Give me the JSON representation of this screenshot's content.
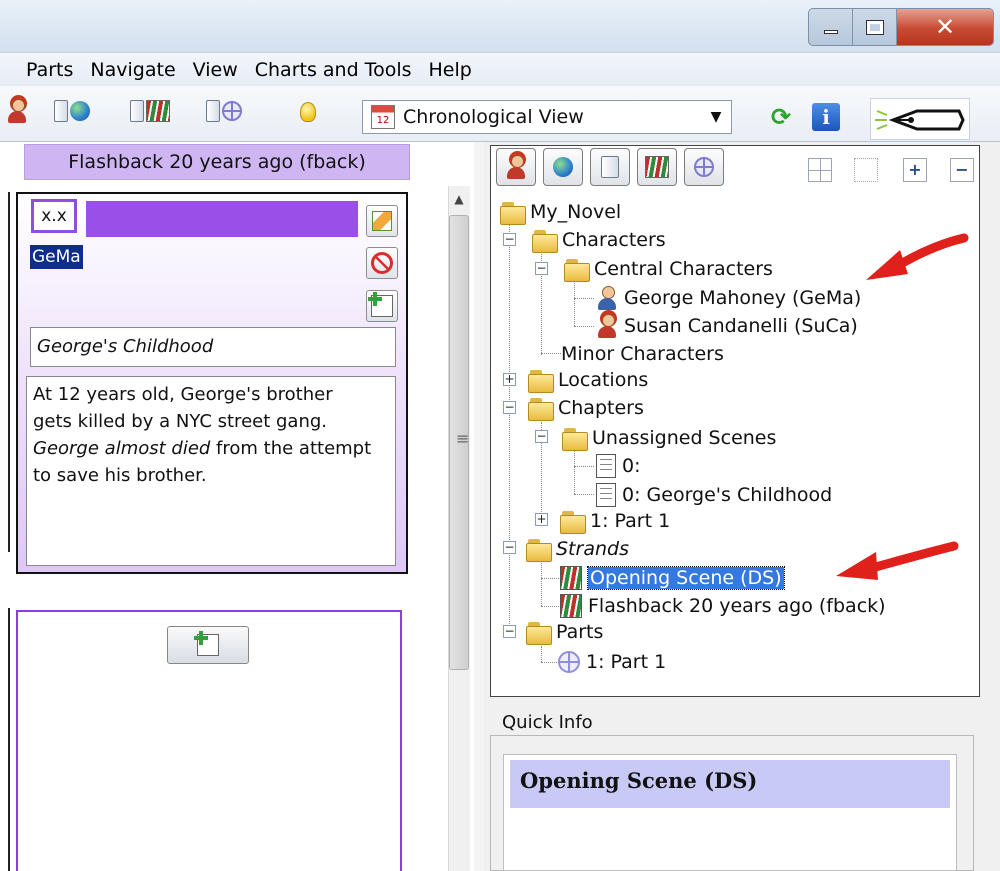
{
  "menu": {
    "items": [
      "Parts",
      "Navigate",
      "View",
      "Charts and Tools",
      "Help"
    ]
  },
  "toolbar": {
    "view_select_value": "Chronological View",
    "calendar_number": "12"
  },
  "window": {
    "close_glyph": "✕"
  },
  "strand_header": "Flashback 20 years ago (fback)",
  "scene_card": {
    "number": "x.x",
    "character_tag": "GeMa",
    "title": "George's Childhood",
    "description_line1": "At 12 years old, George's brother",
    "description_line2": "gets killed by a NYC street gang.",
    "description_italic": "George almost died",
    "description_line3_rest": " from the attempt",
    "description_line4": "to save his brother."
  },
  "tree": {
    "root": "My_Novel",
    "characters": "Characters",
    "central_characters": "Central Characters",
    "char1": "George Mahoney (GeMa)",
    "char2": "Susan Candanelli (SuCa)",
    "minor_characters": "Minor Characters",
    "locations": "Locations",
    "chapters": "Chapters",
    "unassigned_scenes": "Unassigned Scenes",
    "scene0": "0:",
    "scene0b": "0: George's Childhood",
    "part1_chapter": "1: Part 1",
    "strands": "Strands",
    "strand1": "Opening Scene (DS)",
    "strand2": "Flashback 20 years ago (fback)",
    "parts": "Parts",
    "part1": "1: Part 1"
  },
  "quick_info": {
    "label": "Quick Info",
    "title": "Opening Scene (DS)"
  },
  "colors": {
    "strand_header_bg": "#cfb6f3",
    "scene_bar": "#9a4fe8",
    "selection": "#3478e0",
    "arrow": "#e0201a"
  }
}
